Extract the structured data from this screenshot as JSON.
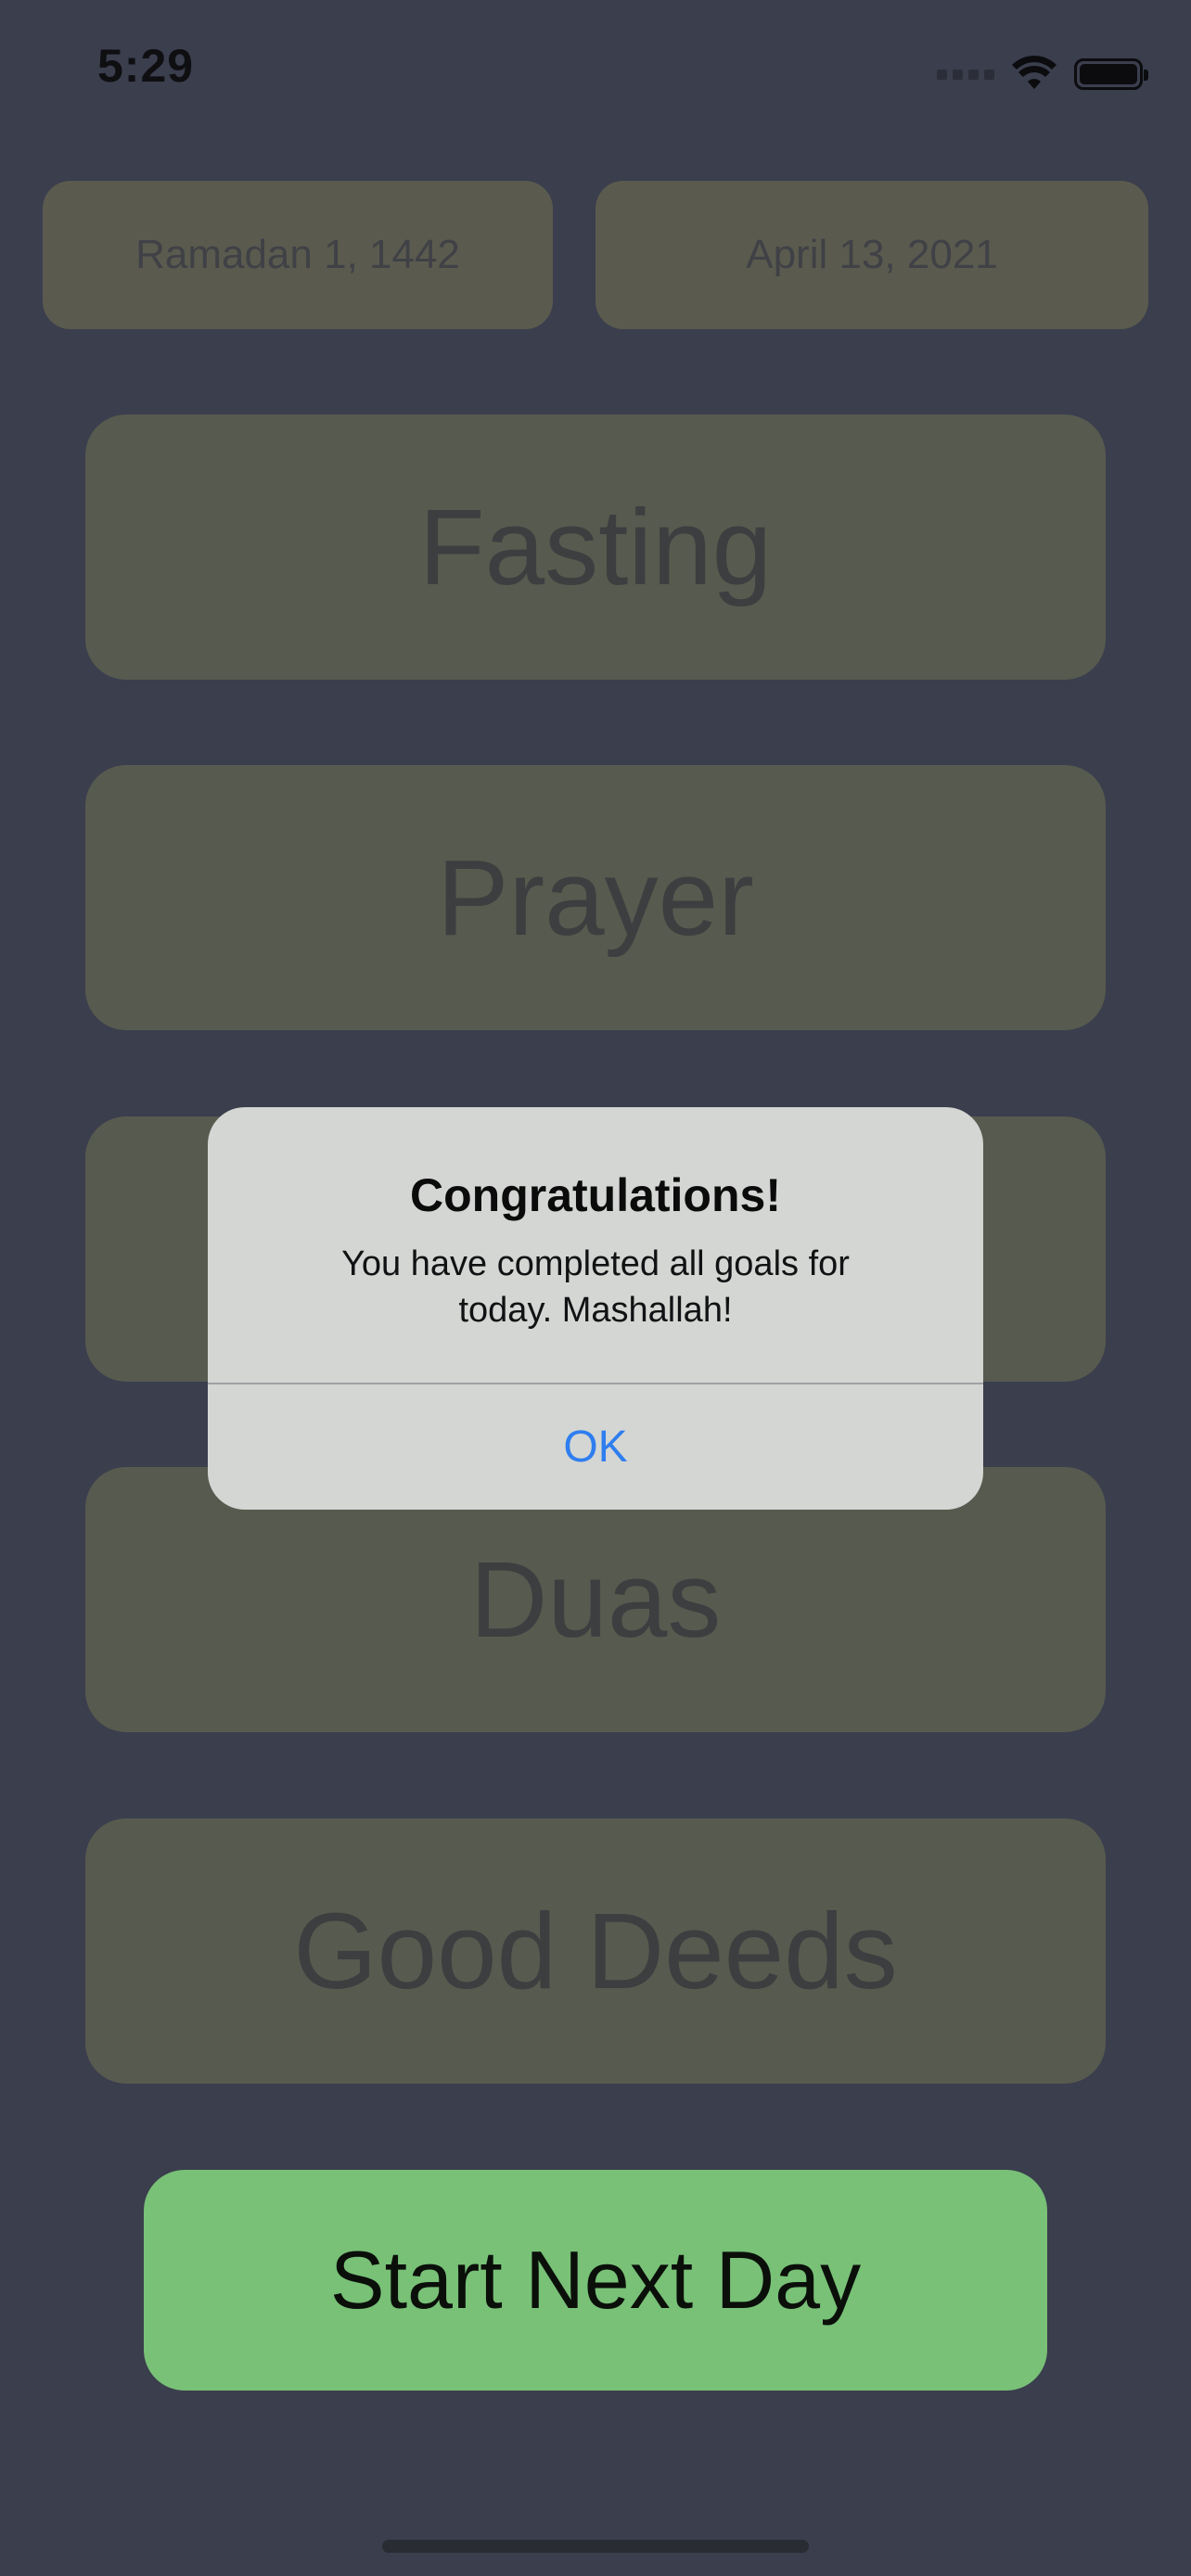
{
  "status_bar": {
    "time": "5:29",
    "icons": [
      "cellular-signal-icon",
      "wifi-icon",
      "battery-icon"
    ]
  },
  "dates": {
    "hijri": "Ramadan 1, 1442",
    "gregorian": "April 13, 2021"
  },
  "goals": [
    {
      "label": "Fasting"
    },
    {
      "label": "Prayer"
    },
    {
      "label": ""
    },
    {
      "label": "Duas"
    },
    {
      "label": "Good Deeds"
    }
  ],
  "actions": {
    "start_next_day": "Start Next Day"
  },
  "alert": {
    "title": "Congratulations!",
    "message": "You have completed all goals for today. Mashallah!",
    "ok_label": "OK"
  },
  "colors": {
    "background": "#3a3e4d",
    "card": "#575a4e",
    "start_button": "#78c177",
    "alert_background": "#d4d6d3",
    "alert_action": "#2f7ef0"
  }
}
